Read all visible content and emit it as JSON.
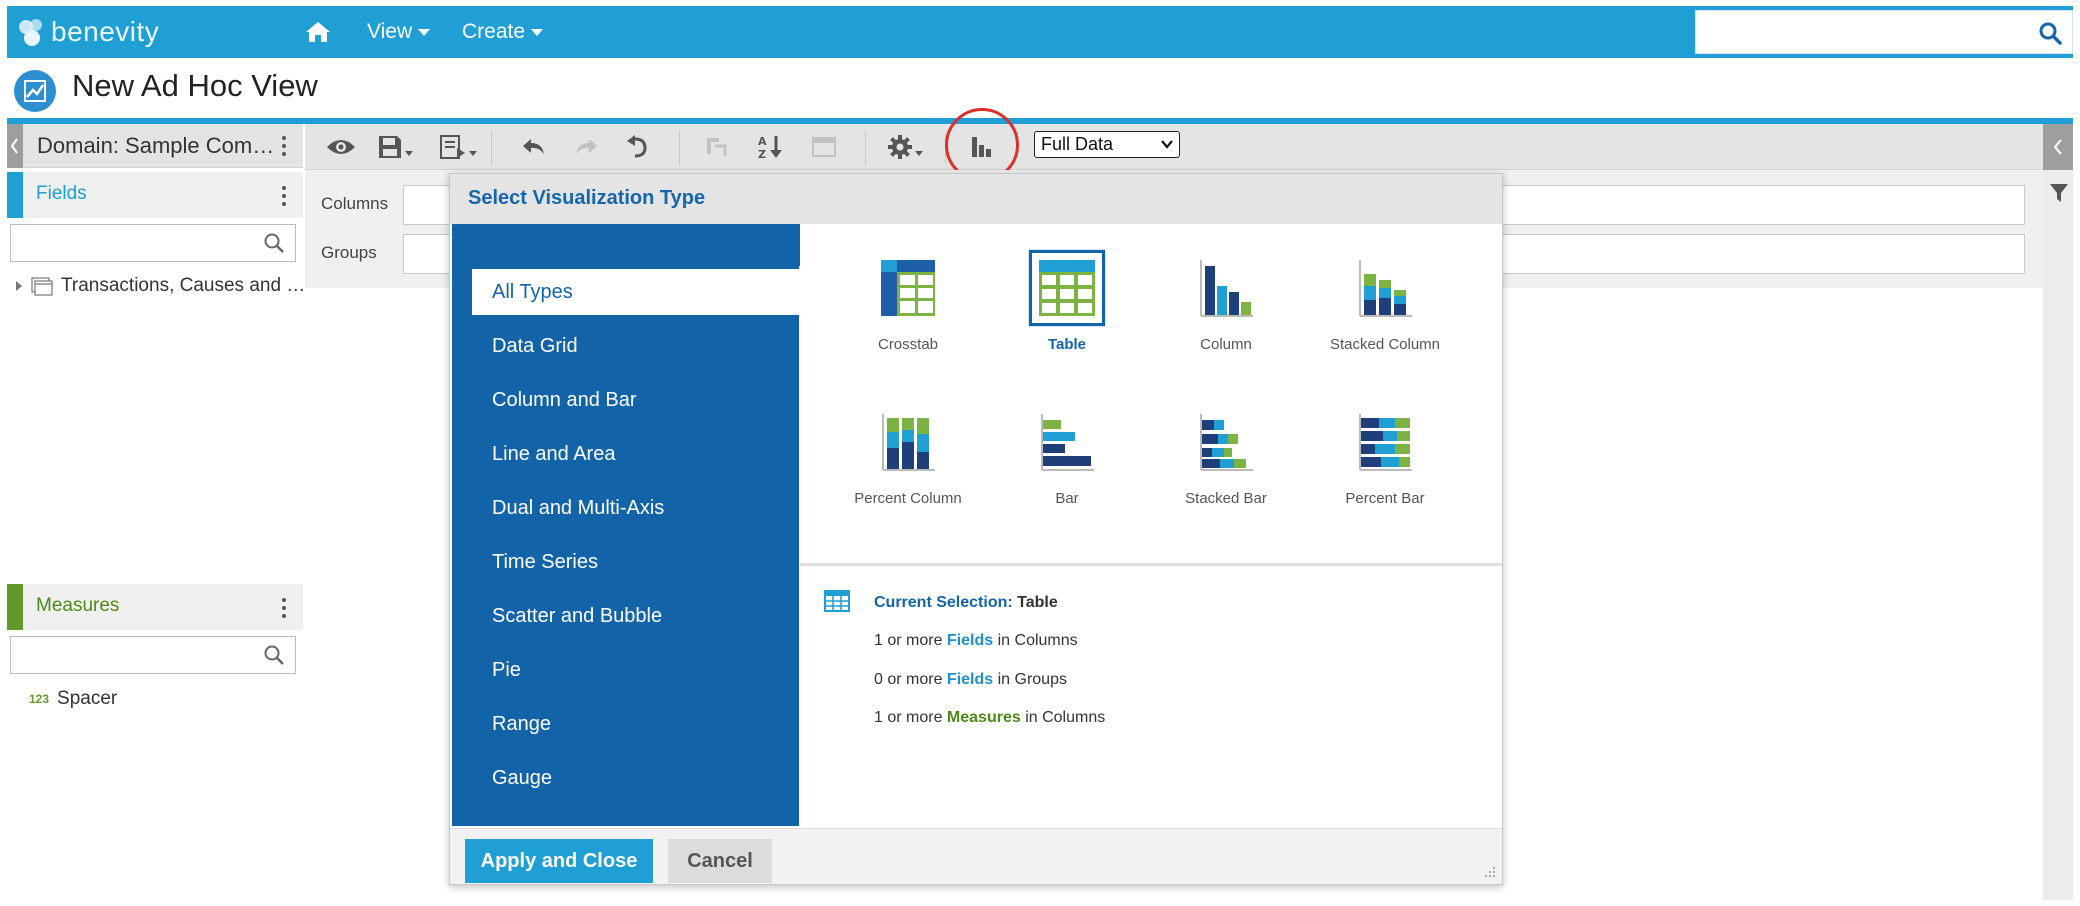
{
  "header": {
    "brand": "benevity",
    "nav": [
      {
        "label": "View"
      },
      {
        "label": "Create"
      }
    ],
    "search_placeholder": ""
  },
  "page": {
    "title": "New Ad Hoc View"
  },
  "left_panel": {
    "domain_label": "Domain: Sample Com…",
    "fields": {
      "label": "Fields",
      "search_placeholder": "",
      "tree_item": "Transactions, Causes and …"
    },
    "measures": {
      "label": "Measures",
      "search_placeholder": "",
      "item_prefix": "123",
      "item": "Spacer"
    }
  },
  "toolbar": {
    "data_select": "Full Data",
    "data_options": [
      "Full Data"
    ]
  },
  "layout_area": {
    "columns_label": "Columns",
    "groups_label": "Groups"
  },
  "dialog": {
    "title": "Select Visualization Type",
    "types": [
      {
        "label": "All Types",
        "active": true
      },
      {
        "label": "Data Grid"
      },
      {
        "label": "Column and Bar"
      },
      {
        "label": "Line and Area"
      },
      {
        "label": "Dual and Multi-Axis"
      },
      {
        "label": "Time Series"
      },
      {
        "label": "Scatter and Bubble"
      },
      {
        "label": "Pie"
      },
      {
        "label": "Range"
      },
      {
        "label": "Gauge"
      }
    ],
    "visualizations": [
      {
        "label": "Crosstab"
      },
      {
        "label": "Table",
        "selected": true
      },
      {
        "label": "Column"
      },
      {
        "label": "Stacked Column"
      },
      {
        "label": "Percent Column"
      },
      {
        "label": "Bar"
      },
      {
        "label": "Stacked Bar"
      },
      {
        "label": "Percent Bar"
      }
    ],
    "current_selection": {
      "label": "Current Selection:",
      "value": "Table",
      "requirements": [
        {
          "prefix": "1 or more",
          "kind": "Fields",
          "suffix": "in Columns"
        },
        {
          "prefix": "0 or more",
          "kind": "Fields",
          "suffix": "in Groups"
        },
        {
          "prefix": "1 or more",
          "kind": "Measures",
          "suffix": "in Columns"
        }
      ]
    },
    "apply_label": "Apply and Close",
    "cancel_label": "Cancel"
  },
  "colors": {
    "header_blue": "#1f9fd3",
    "dialog_blue": "#1363a8",
    "fields_accent": "#1f9fd3",
    "measures_accent": "#5f9a2a",
    "highlight_circle": "#d9302b"
  }
}
